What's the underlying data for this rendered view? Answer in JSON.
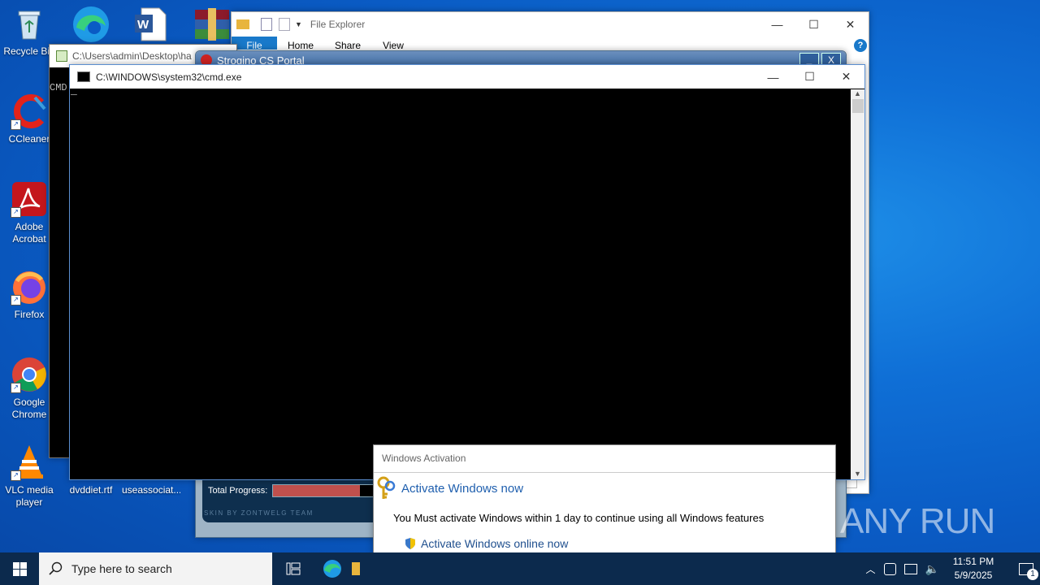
{
  "desktop_icons": [
    {
      "label": "Recycle Bin",
      "icon": "recycle-bin-icon"
    },
    {
      "label": "CCleaner",
      "icon": "ccleaner-icon"
    },
    {
      "label": "Adobe Acrobat",
      "icon": "acrobat-icon"
    },
    {
      "label": "Firefox",
      "icon": "firefox-icon"
    },
    {
      "label": "Google Chrome",
      "icon": "chrome-icon"
    },
    {
      "label": "VLC media player",
      "icon": "vlc-icon"
    },
    {
      "label": "dvddiet.rtf",
      "icon": "rtf-file-icon"
    },
    {
      "label": "useassociat...",
      "icon": "file-icon"
    }
  ],
  "explorer": {
    "title": "File Explorer",
    "tabs": [
      "File",
      "Home",
      "Share",
      "View"
    ]
  },
  "cmd_back": {
    "title": "C:\\Users\\admin\\Desktop\\ha",
    "text": "CMD"
  },
  "portal": {
    "title": "Strogino CS Portal",
    "progress_label": "Total Progress:",
    "progress": 0.82,
    "footer": "SKIN BY ZONTWELG TEAM"
  },
  "cmd": {
    "title": "C:\\WINDOWS\\system32\\cmd.exe",
    "cursor": "_"
  },
  "activation": {
    "title": "Windows Activation",
    "heading": "Activate Windows now",
    "message": "You Must activate Windows within 1 day to continue using all Windows features",
    "option": "Activate Windows online now"
  },
  "watermark": "ANY RUN",
  "taskbar": {
    "search_placeholder": "Type here to search",
    "time": "11:51 PM",
    "date": "5/9/2025",
    "notification_count": "1"
  },
  "colors": {
    "accent": "#0078d7",
    "taskbar": "#0c2a4d",
    "cmd_bg": "#000000",
    "progress_fill": "#c0504d"
  }
}
